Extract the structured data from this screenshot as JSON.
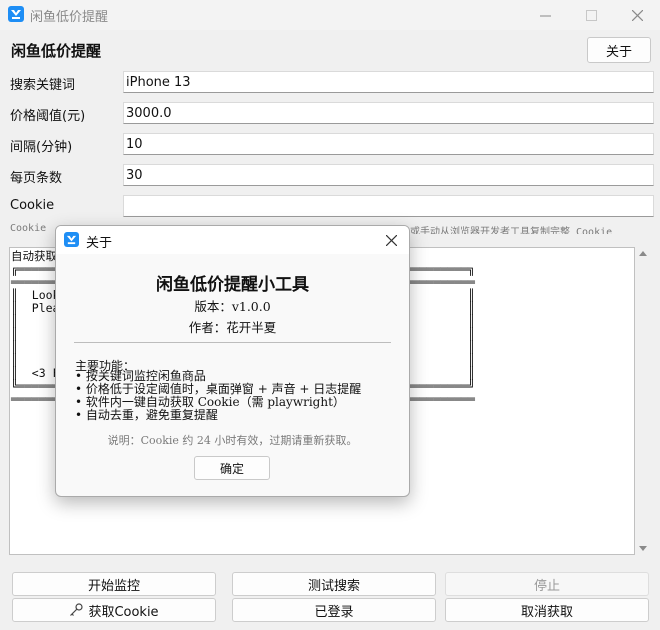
{
  "window": {
    "title": "闲鱼低价提醒"
  },
  "header": {
    "title": "闲鱼低价提醒",
    "about_button": "关于"
  },
  "form": {
    "keyword": {
      "label": "搜索关键词",
      "value": "iPhone 13"
    },
    "price": {
      "label": "价格阈值(元)",
      "value": "3000.0"
    },
    "interval": {
      "label": "间隔(分钟)",
      "value": "10"
    },
    "per_page": {
      "label": "每页条数",
      "value": "30"
    },
    "cookie": {
      "label": "Cookie",
      "value": ""
    }
  },
  "hint": {
    "start": "Cookie",
    "end": "或手动从浏览器开发者工具复制完整 Cookie"
  },
  "log": {
    "text": "自动获取\n╔═══════                                    ══════════════════════╗\n═══════                                     ═══════════════════════\n║  Looki                                                          ║\n║  Plea                                   ers:                    ║\n║                                                                 ║\n║                                                                 ║\n║                                                                 ║\n║                                                                 ║\n║  <3 F                                                           ║\n╚═══════                                    ══════════════════════╝\n═══════                                     ═══════════════════════"
  },
  "buttons": {
    "start": "开始监控",
    "test": "测试搜索",
    "stop": "停止",
    "get_cookie": "获取Cookie",
    "logged_in": "已登录",
    "cancel_get": "取消获取"
  },
  "about_dialog": {
    "title": "关于",
    "app_name": "闲鱼低价提醒小工具",
    "version": "版本：v1.0.0",
    "author": "作者：花开半夏",
    "features_title": "主要功能：",
    "features": [
      "按关键词监控闲鱼商品",
      "价格低于设定阈值时，桌面弹窗 + 声音 + 日志提醒",
      "软件内一键自动获取 Cookie（需 playwright）",
      "自动去重，避免重复提醒"
    ],
    "note": "说明：Cookie 约 24 小时有效，过期请重新获取。",
    "ok_button": "确定"
  },
  "colors": {
    "accent": "#1e8ef5",
    "window_bg": "#f0f0f0"
  }
}
